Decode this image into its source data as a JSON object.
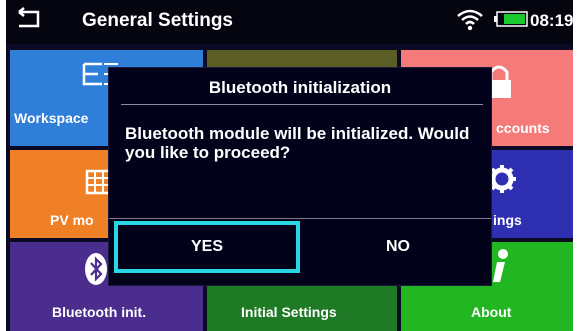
{
  "header": {
    "title": "General Settings",
    "time": "08:19",
    "icons": [
      "back-arrow-icon",
      "wifi-icon",
      "battery-icon"
    ]
  },
  "tiles": [
    {
      "label": "Workspace",
      "icon": "workspace-icon",
      "color": "#2f7fd8"
    },
    {
      "label": "",
      "icon": "",
      "color": "#5a5d24"
    },
    {
      "label": "ccounts",
      "icon": "lock-icon",
      "color": "#f57b7b"
    },
    {
      "label": "PV mo",
      "icon": "pv-grid-icon",
      "color": "#f08026"
    },
    {
      "label": "",
      "icon": "",
      "color": "#1c2a45"
    },
    {
      "label": "ings",
      "icon": "gear-icon",
      "color": "#2f2fb2"
    },
    {
      "label": "Bluetooth init.",
      "icon": "bluetooth-icon",
      "color": "#4a2d8d"
    },
    {
      "label": "Initial Settings",
      "icon": "initial-settings-icon",
      "color": "#1f7a25"
    },
    {
      "label": "About",
      "icon": "info-icon",
      "color": "#22b722"
    }
  ],
  "dialog": {
    "title": "Bluetooth initialization",
    "message": "Bluetooth module will be initialized. Would you like to proceed?",
    "yes_label": "YES",
    "no_label": "NO",
    "focused_button": "YES",
    "focus_color": "#2ad6e6"
  }
}
